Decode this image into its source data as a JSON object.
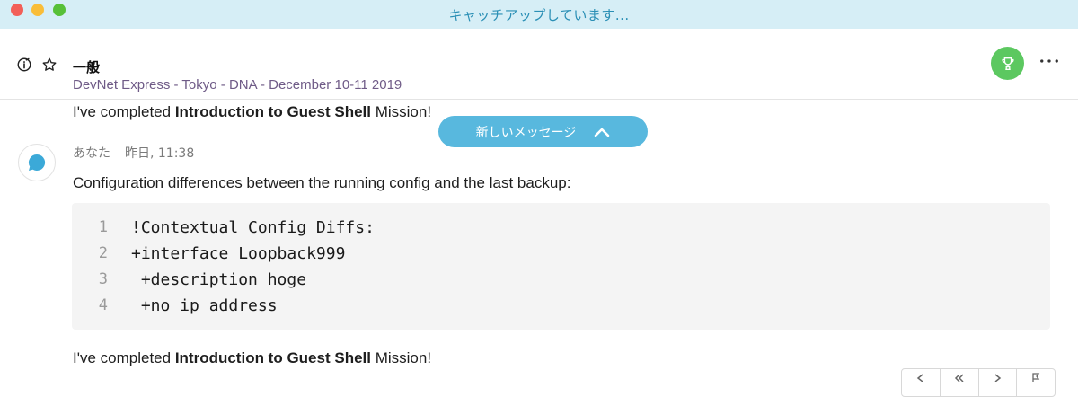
{
  "window": {
    "title": "キャッチアップしています..."
  },
  "header": {
    "space_title": "一般",
    "space_subtitle": "DevNet Express - Tokyo - DNA - December 10-11 2019",
    "icons": [
      "info-icon",
      "star-icon",
      "trophy-icon",
      "more-icon"
    ],
    "trophy_color": "#5cc860"
  },
  "messages": {
    "top_prefix": "I've completed ",
    "top_bold": "Introduction to Guest Shell",
    "top_suffix": " Mission!",
    "new_message_pill": "新しいメッセージ",
    "sender": "あなた",
    "timestamp": "昨日, 11:38",
    "body": "Configuration differences between the running config and the last backup:",
    "code": {
      "lines": [
        {
          "no": "1",
          "text": "!Contextual Config Diffs:"
        },
        {
          "no": "2",
          "text": "+interface Loopback999"
        },
        {
          "no": "3",
          "text": " +description hoge"
        },
        {
          "no": "4",
          "text": " +no ip address"
        }
      ]
    },
    "bottom_prefix": "I've completed ",
    "bottom_bold": "Introduction to Guest Shell",
    "bottom_suffix": " Mission!"
  },
  "colors": {
    "accent": "#58b8de",
    "titlebar": "#d6eef6",
    "subtitle": "#6f5b87"
  }
}
